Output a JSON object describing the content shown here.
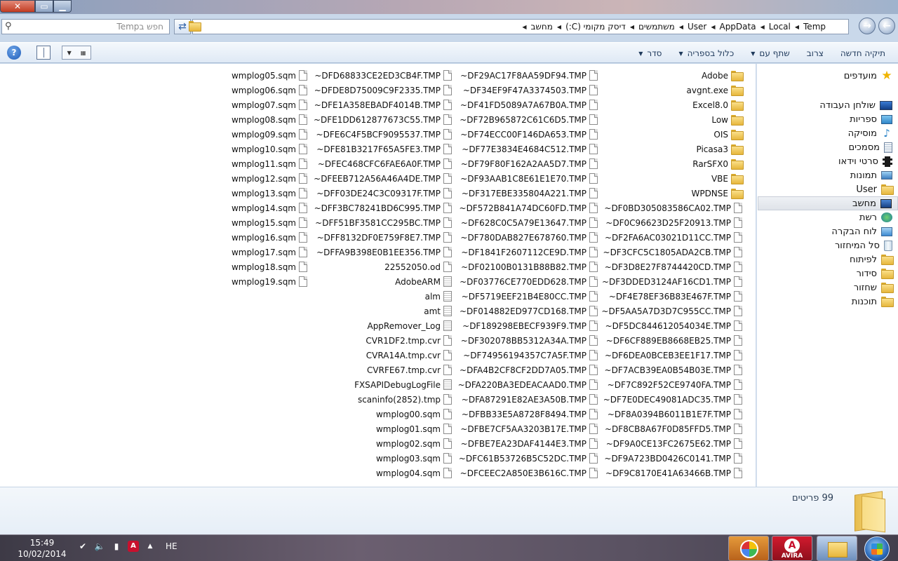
{
  "window": {
    "controls": {
      "close": "✕",
      "maximize": "▭",
      "minimize": "▁"
    }
  },
  "address": {
    "search_placeholder": "חפש בTemp",
    "breadcrumbs": [
      "מחשב",
      "דיסק מקומי (C:)",
      "משתמשים",
      "User",
      "AppData",
      "Local",
      "Temp"
    ]
  },
  "toolbar": {
    "items": [
      {
        "label": "סדר",
        "has_menu": true
      },
      {
        "label": "כלול בספריה",
        "has_menu": true
      },
      {
        "label": "שתף עם",
        "has_menu": true
      },
      {
        "label": "צרוב",
        "has_menu": false
      },
      {
        "label": "תיקיה חדשה",
        "has_menu": false
      }
    ],
    "help_label": "?"
  },
  "navigation": {
    "items": [
      {
        "label": "מועדפים",
        "icon": "star-icon"
      },
      {
        "label": "שולחן העבודה",
        "icon": "desktop-icon"
      },
      {
        "label": "ספריות",
        "icon": "libraries-icon"
      },
      {
        "label": "מוסיקה",
        "icon": "music-icon"
      },
      {
        "label": "מסמכים",
        "icon": "documents-icon"
      },
      {
        "label": "סרטי וידאו",
        "icon": "videos-icon"
      },
      {
        "label": "תמונות",
        "icon": "pictures-icon"
      },
      {
        "label": "User",
        "icon": "user-folder-icon"
      },
      {
        "label": "מחשב",
        "icon": "computer-icon",
        "selected": true
      },
      {
        "label": "רשת",
        "icon": "network-icon"
      },
      {
        "label": "לוח הבקרה",
        "icon": "control-panel-icon"
      },
      {
        "label": "סל המיחזור",
        "icon": "recycle-bin-icon"
      },
      {
        "label": "לפיתוח",
        "icon": "folder-icon"
      },
      {
        "label": "סידור",
        "icon": "folder-icon"
      },
      {
        "label": "שחזור",
        "icon": "folder-icon"
      },
      {
        "label": "תוכנות",
        "icon": "folder-icon"
      }
    ]
  },
  "files": {
    "columns": [
      [
        {
          "name": "Adobe",
          "type": "folder"
        },
        {
          "name": "avgnt.exe",
          "type": "folder"
        },
        {
          "name": "Excel8.0",
          "type": "folder"
        },
        {
          "name": "Low",
          "type": "folder"
        },
        {
          "name": "OIS",
          "type": "folder"
        },
        {
          "name": "Picasa3",
          "type": "folder"
        },
        {
          "name": "RarSFX0",
          "type": "folder"
        },
        {
          "name": "VBE",
          "type": "folder"
        },
        {
          "name": "WPDNSE",
          "type": "folder"
        },
        {
          "name": "~DF0BD305083586CA02.TMP",
          "type": "file"
        },
        {
          "name": "~DF0C96623D25F20913.TMP",
          "type": "file"
        },
        {
          "name": "~DF2FA6AC03021D11CC.TMP",
          "type": "file"
        },
        {
          "name": "~DF3CFC5C1805ADA2CB.TMP",
          "type": "file"
        },
        {
          "name": "~DF3D8E27F8744420CD.TMP",
          "type": "file"
        },
        {
          "name": "~DF3DDED3124AF16CD1.TMP",
          "type": "file"
        },
        {
          "name": "~DF4E78EF36B83E467F.TMP",
          "type": "file"
        },
        {
          "name": "~DF5AA5A7D3D7C955CC.TMP",
          "type": "file"
        },
        {
          "name": "~DF5DC844612054034E.TMP",
          "type": "file"
        },
        {
          "name": "~DF6CF889EB8668EB25.TMP",
          "type": "file"
        },
        {
          "name": "~DF6DEA0BCEB3EE1F17.TMP",
          "type": "file"
        },
        {
          "name": "~DF7ACB39EA0B54B03E.TMP",
          "type": "file"
        },
        {
          "name": "~DF7C892F52CE9740FA.TMP",
          "type": "file"
        },
        {
          "name": "~DF7E0DEC49081ADC35.TMP",
          "type": "file"
        },
        {
          "name": "~DF8A0394B6011B1E7F.TMP",
          "type": "file"
        },
        {
          "name": "~DF8CB8A67F0D85FFD5.TMP",
          "type": "file"
        },
        {
          "name": "~DF9A0CE13FC2675E62.TMP",
          "type": "file"
        },
        {
          "name": "~DF9A723BD0426C0141.TMP",
          "type": "file"
        },
        {
          "name": "~DF9C8170E41A63466B.TMP",
          "type": "file"
        }
      ],
      [
        {
          "name": "~DF29AC17F8AA59DF94.TMP",
          "type": "file"
        },
        {
          "name": "~DF34EF9F47A3374503.TMP",
          "type": "file"
        },
        {
          "name": "~DF41FD5089A7A67B0A.TMP",
          "type": "file"
        },
        {
          "name": "~DF72B965872C61C6D5.TMP",
          "type": "file"
        },
        {
          "name": "~DF74ECC00F146DA653.TMP",
          "type": "file"
        },
        {
          "name": "~DF77E3834E4684C512.TMP",
          "type": "file"
        },
        {
          "name": "~DF79F80F162A2AA5D7.TMP",
          "type": "file"
        },
        {
          "name": "~DF93AAB1C8E61E1E70.TMP",
          "type": "file"
        },
        {
          "name": "~DF317EBE335804A221.TMP",
          "type": "file"
        },
        {
          "name": "~DF572B841A74DC60FD.TMP",
          "type": "file"
        },
        {
          "name": "~DF628C0C5A79E13647.TMP",
          "type": "file"
        },
        {
          "name": "~DF780DAB827E678760.TMP",
          "type": "file"
        },
        {
          "name": "~DF1841F2607112CE9D.TMP",
          "type": "file"
        },
        {
          "name": "~DF02100B0131B88B82.TMP",
          "type": "file"
        },
        {
          "name": "~DF03776CE770EDD628.TMP",
          "type": "file"
        },
        {
          "name": "~DF5719EEF21B4E80CC.TMP",
          "type": "file"
        },
        {
          "name": "~DF014882ED977CD168.TMP",
          "type": "file"
        },
        {
          "name": "~DF189298EBECF939F9.TMP",
          "type": "file"
        },
        {
          "name": "~DF302078BB5312A34A.TMP",
          "type": "file"
        },
        {
          "name": "~DF74956194357C7A5F.TMP",
          "type": "file"
        },
        {
          "name": "~DFA4B2CF8CF2DD7A05.TMP",
          "type": "file"
        },
        {
          "name": "~DFA220BA3EDEACAAD0.TMP",
          "type": "file"
        },
        {
          "name": "~DFA87291E82AE3A50B.TMP",
          "type": "file"
        },
        {
          "name": "~DFBB33E5A8728F8494.TMP",
          "type": "file"
        },
        {
          "name": "~DFBE7CF5AA3203B17E.TMP",
          "type": "file"
        },
        {
          "name": "~DFBE7EA23DAF4144E3.TMP",
          "type": "file"
        },
        {
          "name": "~DFC61B53726B5C52DC.TMP",
          "type": "file"
        },
        {
          "name": "~DFCEEC2A850E3B616C.TMP",
          "type": "file"
        }
      ],
      [
        {
          "name": "~DFD68833CE2ED3CB4F.TMP",
          "type": "file"
        },
        {
          "name": "~DFDE8D75009C9F2335.TMP",
          "type": "file"
        },
        {
          "name": "~DFE1A358EBADF4014B.TMP",
          "type": "file"
        },
        {
          "name": "~DFE1DD612877673C55.TMP",
          "type": "file"
        },
        {
          "name": "~DFE6C4F5BCF9095537.TMP",
          "type": "file"
        },
        {
          "name": "~DFE81B3217F65A5FE3.TMP",
          "type": "file"
        },
        {
          "name": "~DFEC468CFC6FAE6A0F.TMP",
          "type": "file"
        },
        {
          "name": "~DFEEB712A56A46A4DE.TMP",
          "type": "file"
        },
        {
          "name": "~DFF03DE24C3C09317F.TMP",
          "type": "file"
        },
        {
          "name": "~DFF3BC78241BD6C995.TMP",
          "type": "file"
        },
        {
          "name": "~DFF51BF3581CC295BC.TMP",
          "type": "file"
        },
        {
          "name": "~DFF8132DF0E759F8E7.TMP",
          "type": "file"
        },
        {
          "name": "~DFFA9B398E0B1EE356.TMP",
          "type": "file"
        },
        {
          "name": "22552050.od",
          "type": "file"
        },
        {
          "name": "AdobeARM",
          "type": "doc"
        },
        {
          "name": "alm",
          "type": "doc"
        },
        {
          "name": "amt",
          "type": "doc"
        },
        {
          "name": "AppRemover_Log",
          "type": "doc"
        },
        {
          "name": "CVR1DF2.tmp.cvr",
          "type": "file"
        },
        {
          "name": "CVRA14A.tmp.cvr",
          "type": "file"
        },
        {
          "name": "CVRFE67.tmp.cvr",
          "type": "file"
        },
        {
          "name": "FXSAPIDebugLogFile",
          "type": "doc"
        },
        {
          "name": "scaninfo(2852).tmp",
          "type": "file"
        },
        {
          "name": "wmplog00.sqm",
          "type": "file"
        },
        {
          "name": "wmplog01.sqm",
          "type": "file"
        },
        {
          "name": "wmplog02.sqm",
          "type": "file"
        },
        {
          "name": "wmplog03.sqm",
          "type": "file"
        },
        {
          "name": "wmplog04.sqm",
          "type": "file"
        }
      ],
      [
        {
          "name": "wmplog05.sqm",
          "type": "file"
        },
        {
          "name": "wmplog06.sqm",
          "type": "file"
        },
        {
          "name": "wmplog07.sqm",
          "type": "file"
        },
        {
          "name": "wmplog08.sqm",
          "type": "file"
        },
        {
          "name": "wmplog09.sqm",
          "type": "file"
        },
        {
          "name": "wmplog10.sqm",
          "type": "file"
        },
        {
          "name": "wmplog11.sqm",
          "type": "file"
        },
        {
          "name": "wmplog12.sqm",
          "type": "file"
        },
        {
          "name": "wmplog13.sqm",
          "type": "file"
        },
        {
          "name": "wmplog14.sqm",
          "type": "file"
        },
        {
          "name": "wmplog15.sqm",
          "type": "file"
        },
        {
          "name": "wmplog16.sqm",
          "type": "file"
        },
        {
          "name": "wmplog17.sqm",
          "type": "file"
        },
        {
          "name": "wmplog18.sqm",
          "type": "file"
        },
        {
          "name": "wmplog19.sqm",
          "type": "file"
        }
      ]
    ]
  },
  "details": {
    "item_count": "99 פריטים"
  },
  "taskbar": {
    "time": "15:49",
    "date": "10/02/2014",
    "language": "HE",
    "apps": [
      "Picasa",
      "AVIRA",
      "Windows Explorer"
    ]
  }
}
